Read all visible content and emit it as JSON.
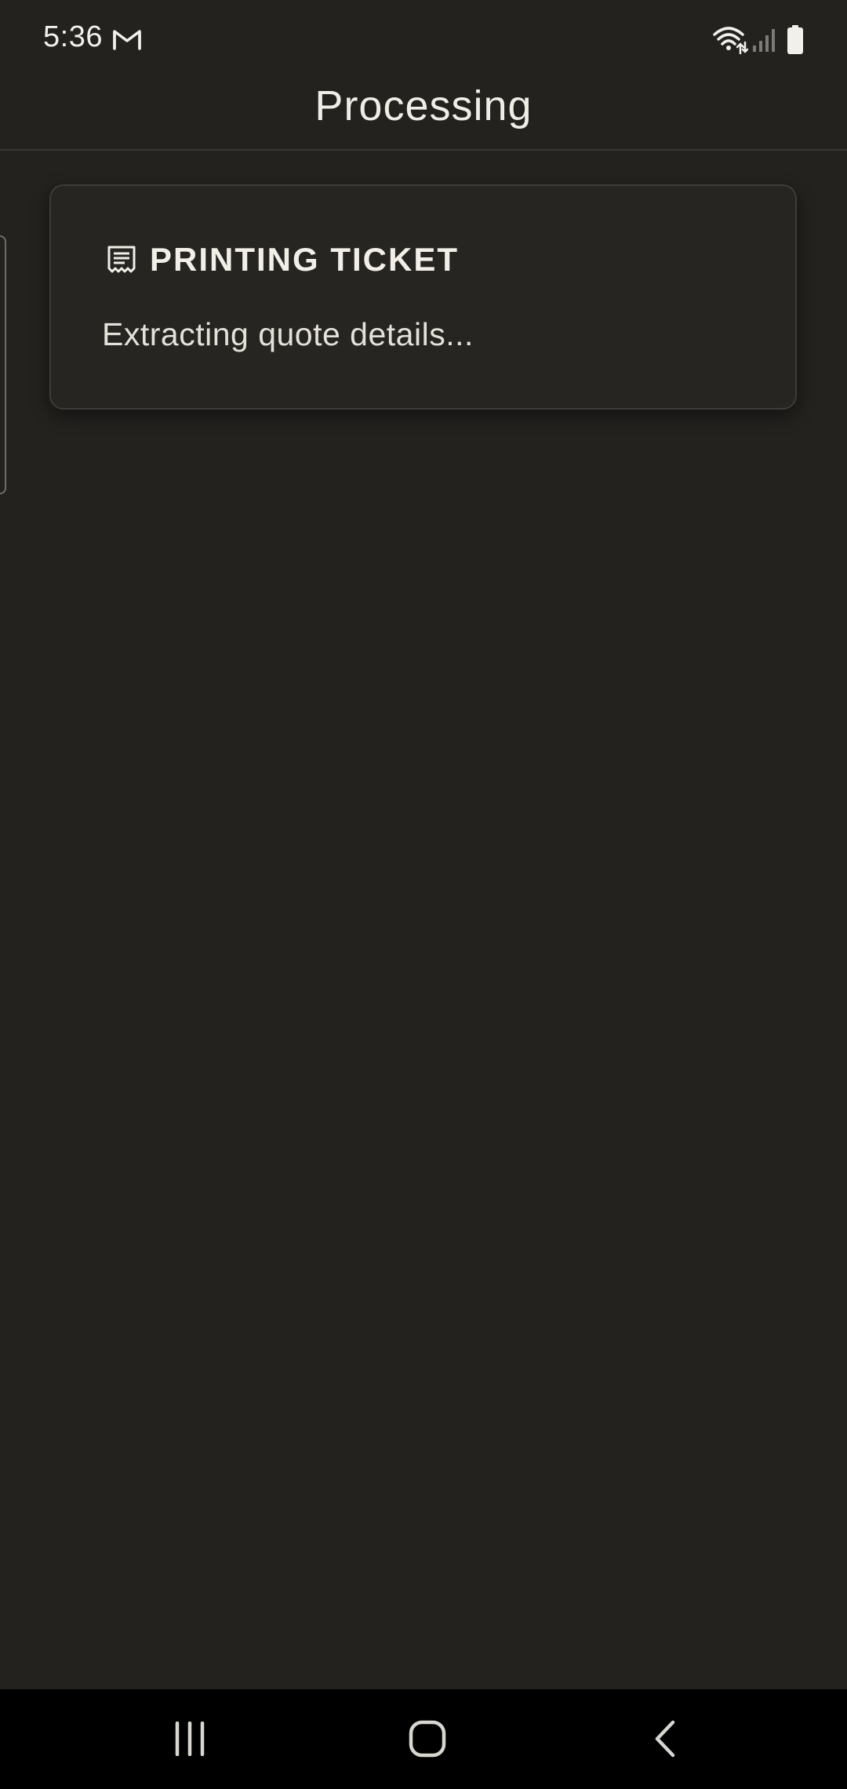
{
  "status_bar": {
    "time": "5:36",
    "icons": [
      "gmail-icon",
      "wifi-icon",
      "cell-signal-icon",
      "battery-icon"
    ]
  },
  "header": {
    "title": "Processing"
  },
  "card": {
    "icon": "receipt-icon",
    "title": "PRINTING TICKET",
    "message": "Extracting quote details..."
  },
  "nav_bar": {
    "buttons": [
      "recent-apps",
      "home",
      "back"
    ]
  },
  "colors": {
    "background": "#23221f",
    "card_background": "#262522",
    "card_border": "#3d3c38",
    "text_primary": "#f2efe8",
    "nav_background": "#000000"
  }
}
